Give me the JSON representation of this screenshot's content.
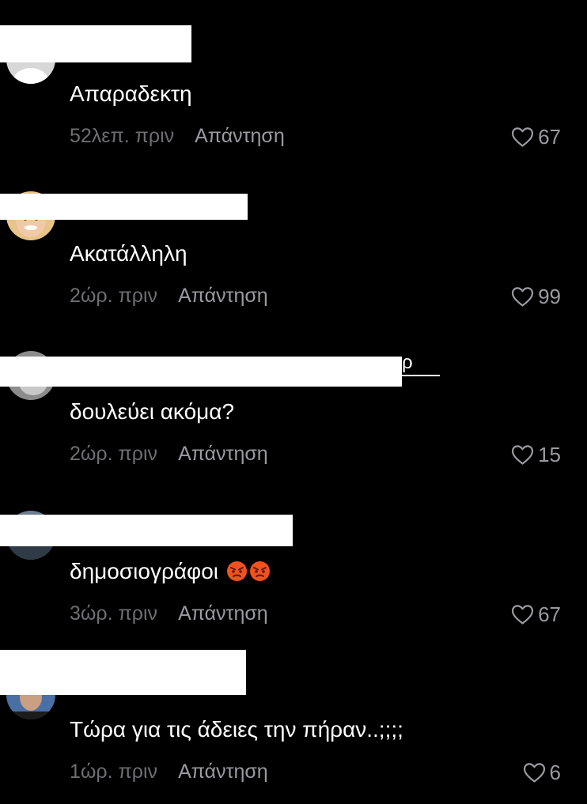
{
  "comments": [
    {
      "text": "Απαραδεκτη",
      "time": "52λεπ. πριν",
      "reply_label": "Απάντηση",
      "likes": "67",
      "avatar": "default-avatar"
    },
    {
      "text": "Ακατάλληλη",
      "time": "2ώρ. πριν",
      "reply_label": "Απάντηση",
      "likes": "99",
      "avatar": "woman-blonde-avatar"
    },
    {
      "text": "δουλεύει ακόμα?",
      "time": "2ώρ. πριν",
      "reply_label": "Απάντηση",
      "likes": "15",
      "avatar": "grey-photo-avatar",
      "username_tail": "ρ"
    },
    {
      "text": "δημοσιογράφοι",
      "emojis": [
        "angry-face-emoji",
        "angry-face-emoji"
      ],
      "time": "3ώρ. πριν",
      "reply_label": "Απάντηση",
      "likes": "67",
      "avatar": "landscape-avatar"
    },
    {
      "text": "Τώρα για τις άδειες την πήραν..;;;;",
      "time": "1ώρ. πριν",
      "reply_label": "Απάντηση",
      "likes": "6",
      "avatar": "man-avatar"
    }
  ],
  "colors": {
    "background": "#000000",
    "text": "#ffffff",
    "muted": "#6e6e73",
    "action": "#9a9aa0"
  }
}
